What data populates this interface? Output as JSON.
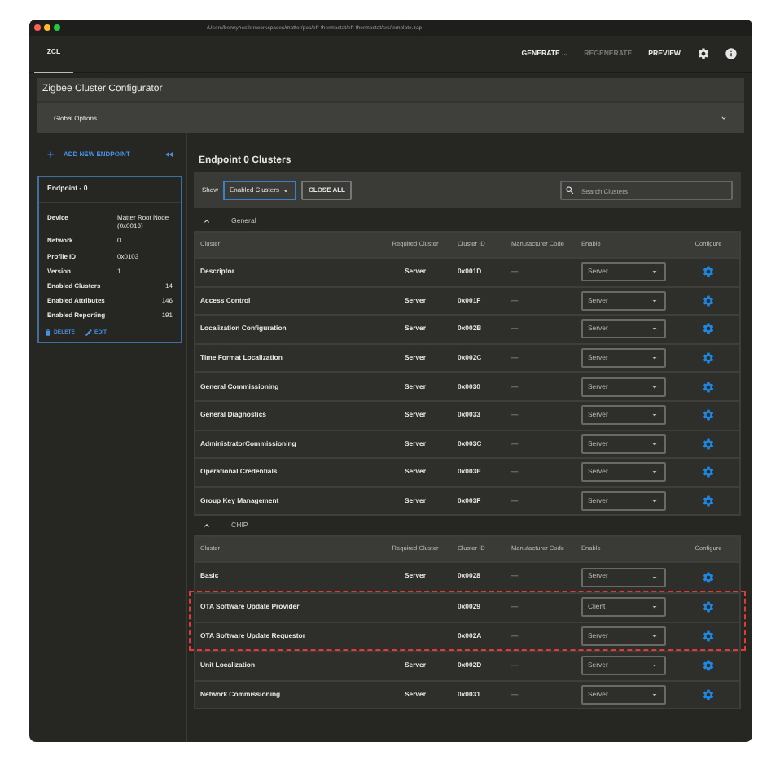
{
  "window": {
    "title": "/Users/bennynestler/workspaces/matter/poc/efr-thermostat/efr-thermostat/src/template.zap"
  },
  "toolbar": {
    "tabs": [
      {
        "label": "ZCL",
        "selected": true
      }
    ],
    "actions": [
      {
        "label": "GENERATE ...",
        "disabled": false
      },
      {
        "label": "REGENERATE",
        "disabled": true
      },
      {
        "label": "PREVIEW",
        "disabled": false
      }
    ]
  },
  "header": {
    "title": "Zigbee Cluster Configurator",
    "global_options": {
      "label": "Global Options",
      "expanded": false
    }
  },
  "sidebar": {
    "add_button": "ADD NEW ENDPOINT",
    "endpoint": {
      "title": "Endpoint - 0",
      "selected": true,
      "properties": [
        {
          "label": "Device",
          "value": "Matter Root Node (0x0016)"
        },
        {
          "label": "Network",
          "value": "0"
        },
        {
          "label": "Profile ID",
          "value": "0x0103"
        },
        {
          "label": "Version",
          "value": "1"
        },
        {
          "label": "Enabled Clusters",
          "value": "14"
        },
        {
          "label": "Enabled Attributes",
          "value": "146"
        },
        {
          "label": "Enabled Reporting",
          "value": "191"
        }
      ],
      "actions": [
        "DELETE",
        "EDIT"
      ]
    }
  },
  "main": {
    "title": "Endpoint 0 Clusters",
    "show_label": "Show",
    "filter": "Enabled Clusters",
    "close_all": "CLOSE ALL",
    "search": {
      "placeholder": "Search Clusters"
    },
    "groups": [
      {
        "name": "General",
        "expanded": true,
        "columns": [
          "Cluster",
          "Required Cluster",
          "Cluster ID",
          "Manufacturer Code",
          "Enable",
          "Configure"
        ],
        "rows": [
          {
            "cluster": "Descriptor",
            "required": "Server",
            "id": "0x001D",
            "manufacturer_code": "—",
            "enable": "Server",
            "highlighted": false
          },
          {
            "cluster": "Access Control",
            "required": "Server",
            "id": "0x001F",
            "manufacturer_code": "—",
            "enable": "Server",
            "highlighted": false
          },
          {
            "cluster": "Localization Configuration",
            "required": "Server",
            "id": "0x002B",
            "manufacturer_code": "—",
            "enable": "Server",
            "highlighted": false
          },
          {
            "cluster": "Time Format Localization",
            "required": "Server",
            "id": "0x002C",
            "manufacturer_code": "—",
            "enable": "Server",
            "highlighted": false
          },
          {
            "cluster": "General Commissioning",
            "required": "Server",
            "id": "0x0030",
            "manufacturer_code": "—",
            "enable": "Server",
            "highlighted": false
          },
          {
            "cluster": "General Diagnostics",
            "required": "Server",
            "id": "0x0033",
            "manufacturer_code": "—",
            "enable": "Server",
            "highlighted": false
          },
          {
            "cluster": "AdministratorCommissioning",
            "required": "Server",
            "id": "0x003C",
            "manufacturer_code": "—",
            "enable": "Server",
            "highlighted": false
          },
          {
            "cluster": "Operational Credentials",
            "required": "Server",
            "id": "0x003E",
            "manufacturer_code": "—",
            "enable": "Server",
            "highlighted": false
          },
          {
            "cluster": "Group Key Management",
            "required": "Server",
            "id": "0x003F",
            "manufacturer_code": "—",
            "enable": "Server",
            "highlighted": false
          }
        ]
      },
      {
        "name": "CHIP",
        "expanded": true,
        "columns": [
          "Cluster",
          "Required Cluster",
          "Cluster ID",
          "Manufacturer Code",
          "Enable",
          "Configure"
        ],
        "rows": [
          {
            "cluster": "Basic",
            "required": "Server",
            "id": "0x0028",
            "manufacturer_code": "—",
            "enable": "Server",
            "highlighted": false
          },
          {
            "cluster": "OTA Software Update Provider",
            "id": "0x0029",
            "manufacturer_code": "—",
            "enable": "Client",
            "highlighted": true
          },
          {
            "cluster": "OTA Software Update Requestor",
            "id": "0x002A",
            "manufacturer_code": "—",
            "enable": "Server",
            "highlighted": true
          },
          {
            "cluster": "Unit Localization",
            "required": "Server",
            "id": "0x002D",
            "manufacturer_code": "—",
            "enable": "Server",
            "highlighted": false
          },
          {
            "cluster": "Network Commissioning",
            "required": "Server",
            "id": "0x0031",
            "manufacturer_code": "—",
            "enable": "Server",
            "highlighted": false
          }
        ]
      }
    ]
  }
}
